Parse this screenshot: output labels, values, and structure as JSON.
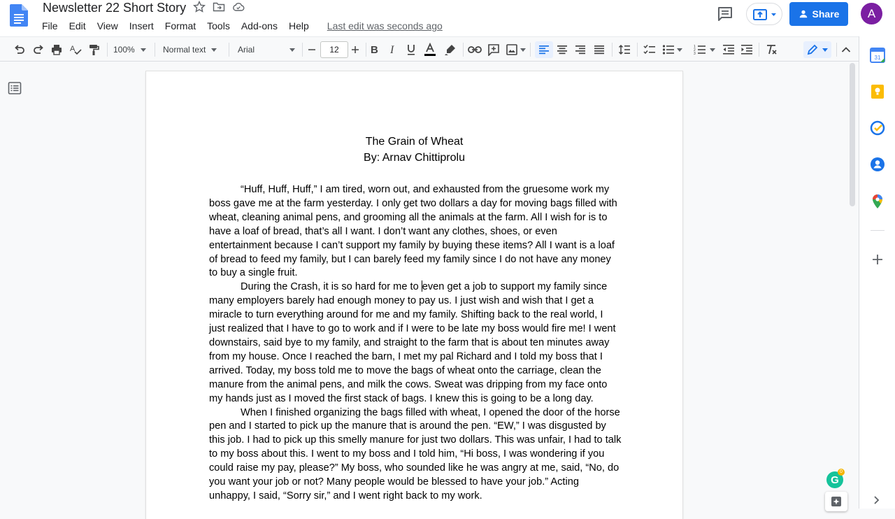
{
  "document": {
    "title": "Newsletter 22 Short Story",
    "last_edit": "Last edit was seconds ago"
  },
  "menu": [
    "File",
    "Edit",
    "View",
    "Insert",
    "Format",
    "Tools",
    "Add-ons",
    "Help"
  ],
  "header": {
    "share_label": "Share",
    "avatar_initial": "A"
  },
  "toolbar": {
    "zoom": "100%",
    "style": "Normal text",
    "font": "Arial",
    "font_size": "12"
  },
  "content": {
    "heading_title": "The Grain of Wheat",
    "heading_author": "By: Arnav Chittiprolu",
    "para1": "“Huff, Huff, Huff,” I am tired, worn out, and exhausted from the gruesome work my boss gave me at the farm yesterday. I only get two dollars a day for moving bags filled with wheat, cleaning animal pens, and grooming all the animals at the farm. All I wish for is to have a loaf of bread, that’s all I want. I don’t want any clothes, shoes, or even entertainment because I can’t support my family by buying these items? All I want is a loaf of bread to feed my family, but I can barely feed my family since I do not have any money to buy a single fruit.",
    "para2_before_cursor": "During the Crash, it is so hard for me to ",
    "para2_after_cursor": "even get a job to support my family since many employers barely had enough money to pay us. I just wish and wish that I get a miracle to turn everything around for me and my family. Shifting back to the real world, I just realized that I have to go to work and if I were to be late my boss would fire me! I went downstairs, said bye to my family, and straight to the farm that is about ten minutes away from my house. Once I reached the barn, I met my pal Richard and I told my boss that I arrived. Today, my boss told me to move the bags of wheat onto the carriage, clean the manure from the animal pens, and milk the cows. Sweat was dripping from my face onto my hands just as I moved the first stack of bags. I knew this is going to be a long day.",
    "para3": "When I finished organizing the bags filled with wheat, I opened the door of the horse pen and I started to pick up the manure that is around the pen. “EW,” I was disgusted by this job. I had to pick up this smelly manure for just two dollars. This was unfair, I had to talk to my boss about this. I went to my boss and I told him, “Hi boss, I was wondering if you could raise my pay, please?” My boss, who sounded like he was angry at me, said, “No, do you want your job or not? Many people would be blessed to have your job.” Acting unhappy, I said, “Sorry sir,” and I went right back to my work."
  },
  "sidepanel": {
    "calendar_day": "31"
  },
  "grammarly_badge": "0",
  "colors": {
    "accent": "#1a73e8",
    "avatar": "#7b1fa2",
    "doc_icon": "#4285f4",
    "text_color_underline": "#000000"
  }
}
